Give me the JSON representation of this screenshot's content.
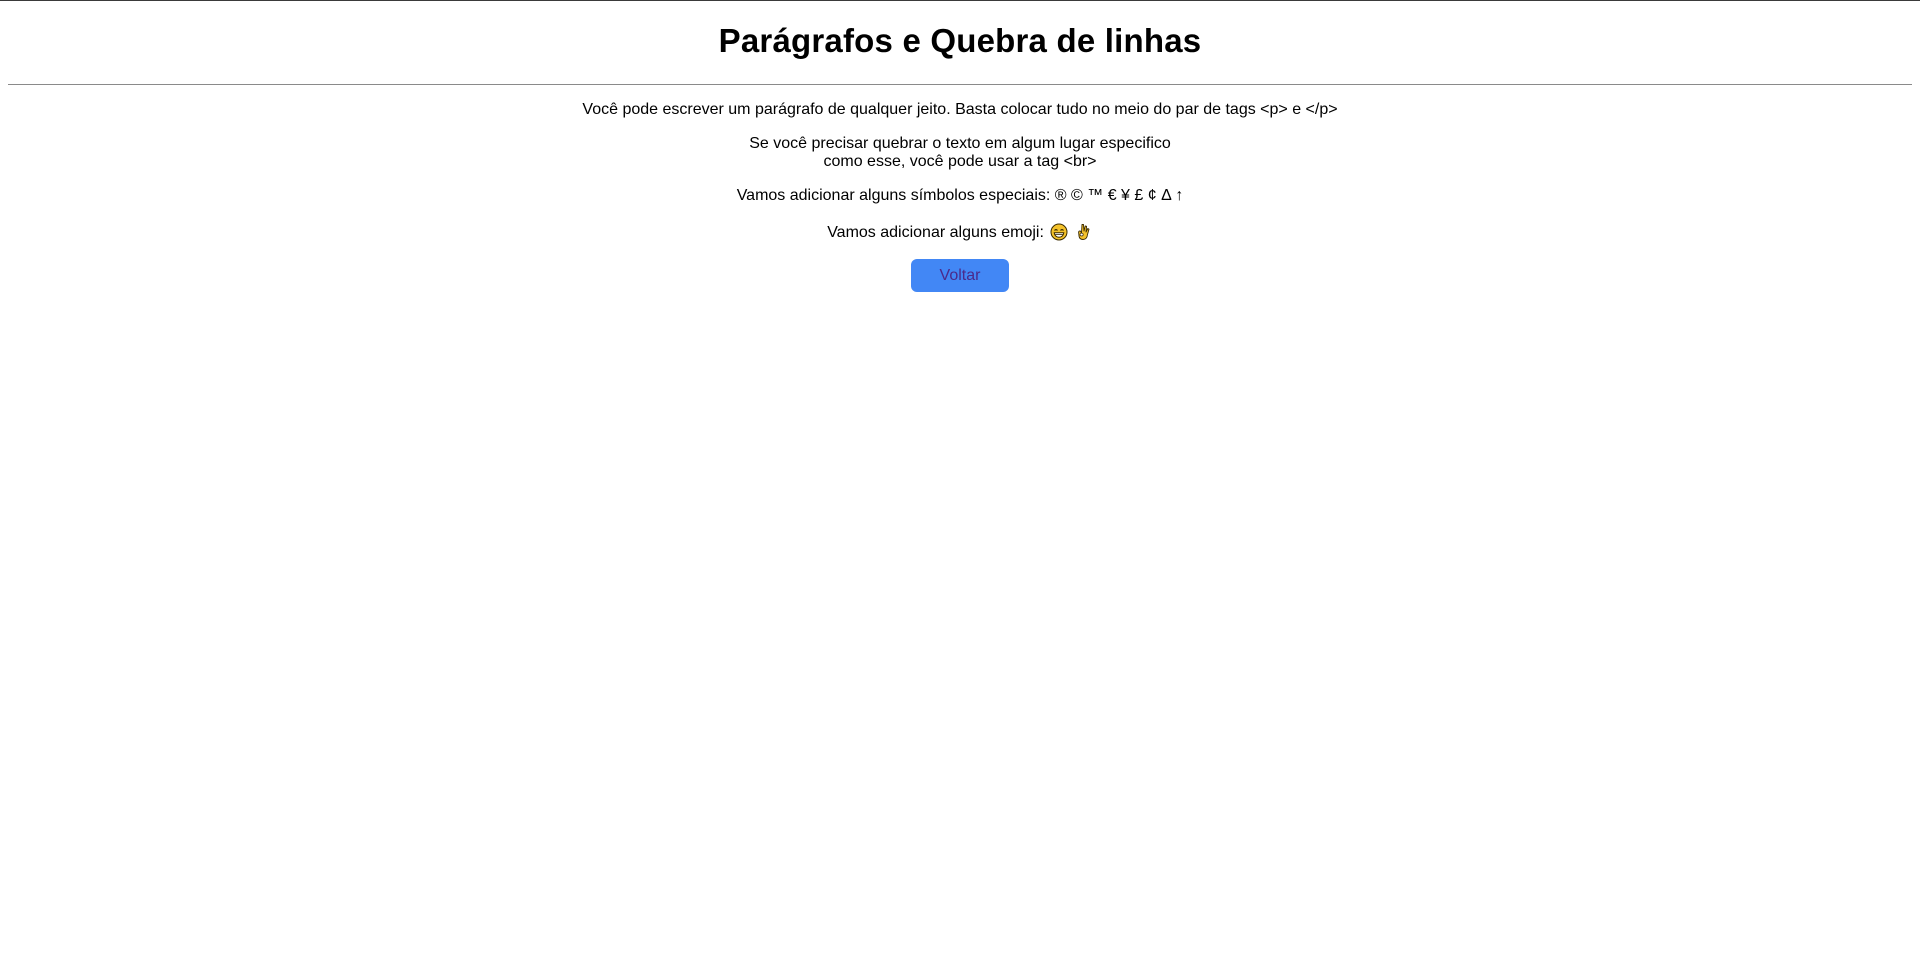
{
  "page": {
    "title": "Parágrafos e Quebra de linhas"
  },
  "content": {
    "paragraph1": "Você pode escrever um parágrafo de qualquer jeito. Basta colocar tudo no meio do par de tags <p> e </p>",
    "paragraph2_line1": "Se você precisar quebrar o texto em algum lugar especifico",
    "paragraph2_line2": "como esse, você pode usar a tag <br>",
    "paragraph3": "Vamos adicionar alguns símbolos especiais: ® © ™ € ¥ £ ¢ Δ ↑",
    "paragraph4": "Vamos adicionar alguns emoji:",
    "emoji_icons": [
      "grinning-face-icon",
      "ok-hand-icon"
    ]
  },
  "actions": {
    "back_label": "Voltar"
  },
  "colors": {
    "button_bg": "#4287f5",
    "button_text": "#4b2a8a",
    "rule": "#8a8a8a"
  }
}
